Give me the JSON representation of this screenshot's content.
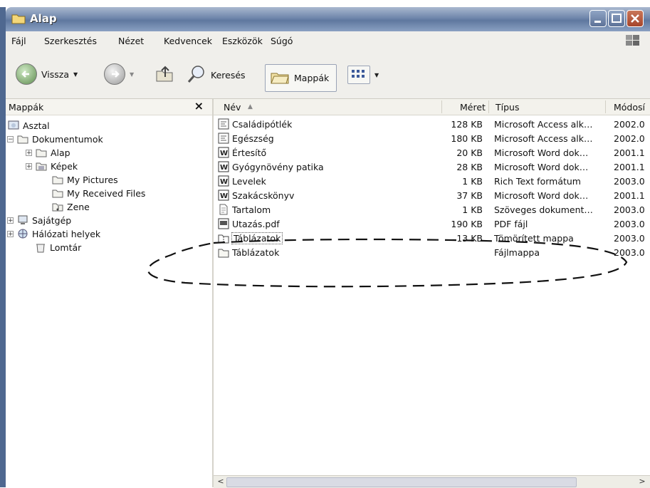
{
  "window": {
    "title": "Alap"
  },
  "menu": [
    "Fájl",
    "Szerkesztés",
    "Nézet",
    "Kedvencek",
    "Eszközök",
    "Súgó"
  ],
  "toolbar": {
    "back_label": "Vissza",
    "search_label": "Keresés",
    "folders_label": "Mappák"
  },
  "left_pane": {
    "title": "Mappák",
    "close_glyph": "×",
    "tree": [
      {
        "label": "Asztal",
        "icon": "desktop-icon"
      },
      {
        "label": "Dokumentumok",
        "icon": "documents-folder-icon",
        "expander": "⊟"
      },
      {
        "label": "Alap",
        "icon": "folder-icon",
        "expander": "+"
      },
      {
        "label": "Képek",
        "icon": "pictures-folder-icon",
        "expander": "+"
      },
      {
        "label": "My Pictures",
        "icon": "folder-icon"
      },
      {
        "label": "My Received Files",
        "icon": "folder-icon"
      },
      {
        "label": "Zene",
        "icon": "music-folder-icon"
      },
      {
        "label": "Sajátgép",
        "icon": "computer-icon",
        "expander": "+"
      },
      {
        "label": "Hálózati helyek",
        "icon": "network-icon",
        "expander": "+"
      },
      {
        "label": "Lomtár",
        "icon": "recycle-bin-icon"
      }
    ]
  },
  "file_list": {
    "columns": {
      "name": "Név",
      "size": "Méret",
      "type": "Típus",
      "modified": "Módosí"
    },
    "rows": [
      {
        "name": "Családipótlék",
        "size": "128 KB",
        "type": "Microsoft Access alk…",
        "modified": "2002.0",
        "icon": "access-file-icon"
      },
      {
        "name": "Egészség",
        "size": "180 KB",
        "type": "Microsoft Access alk…",
        "modified": "2002.0",
        "icon": "access-file-icon"
      },
      {
        "name": "Értesítő",
        "size": "20 KB",
        "type": "Microsoft Word dok…",
        "modified": "2001.1",
        "icon": "word-file-icon"
      },
      {
        "name": "Gyógynövény patika",
        "size": "28 KB",
        "type": "Microsoft Word dok…",
        "modified": "2001.1",
        "icon": "word-file-icon"
      },
      {
        "name": "Levelek",
        "size": "1 KB",
        "type": "Rich Text formátum",
        "modified": "2003.0",
        "icon": "word-file-icon"
      },
      {
        "name": "Szakácskönyv",
        "size": "37 KB",
        "type": "Microsoft Word dok…",
        "modified": "2001.1",
        "icon": "word-file-icon"
      },
      {
        "name": "Tartalom",
        "size": "1 KB",
        "type": "Szöveges dokument…",
        "modified": "2003.0",
        "icon": "text-file-icon"
      },
      {
        "name": "Utazás.pdf",
        "size": "190 KB",
        "type": "PDF fájl",
        "modified": "2003.0",
        "icon": "pdf-file-icon"
      },
      {
        "name": "Táblázatok",
        "size": "13 KB",
        "type": "Tömörített mappa",
        "modified": "2003.0",
        "icon": "zip-folder-icon"
      },
      {
        "name": "Táblázatok",
        "size": "",
        "type": "Fájlmappa",
        "modified": "2003.0",
        "icon": "folder-icon"
      }
    ]
  },
  "scrollbar": {
    "left_arrow": "<",
    "right_arrow": ">"
  }
}
